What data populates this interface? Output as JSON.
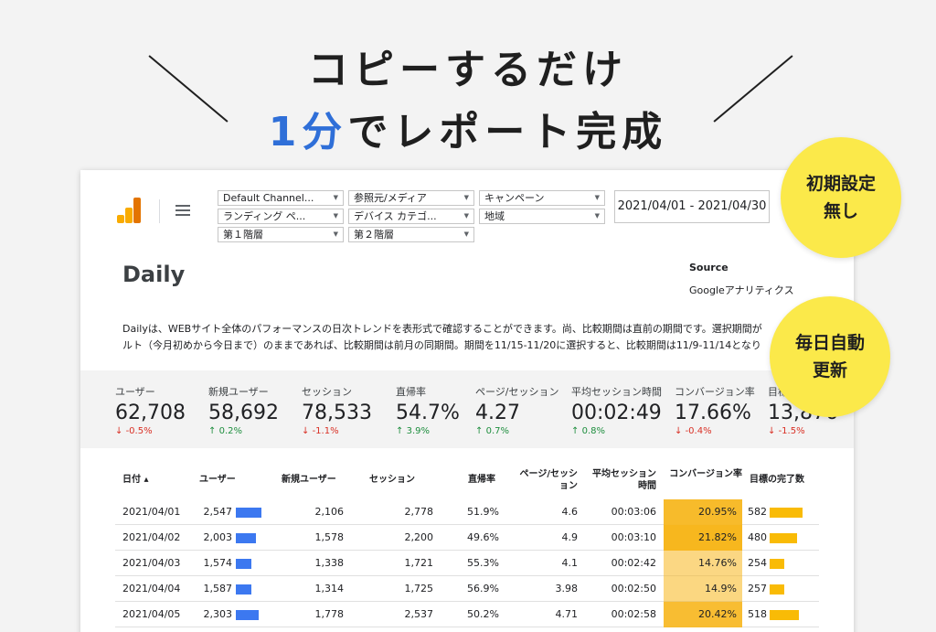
{
  "headline": {
    "line1": "コピーするだけ",
    "line2_accent": "1分",
    "line2_rest": "でレポート完成"
  },
  "badges": {
    "initial_setup": [
      "初期設定",
      "無し"
    ],
    "daily_update": [
      "毎日自動",
      "更新"
    ]
  },
  "filters": [
    "Default Channel...",
    "参照元/メディア",
    "キャンペーン",
    "ランディング ペ...",
    "デバイス カテゴ...",
    "地域",
    "第１階層",
    "第２階層"
  ],
  "date_range": "2021/04/01 - 2021/04/30",
  "report": {
    "title": "Daily",
    "source_label": "Source",
    "source_value": "Googleアナリティクス",
    "description_line1": "Dailyは、WEBサイト全体のパフォーマンスの日次トレンドを表形式で確認することができます。尚、比較期間は直前の期間です。選択期間が",
    "description_line2": "ルト（今月初めから今日まで）のままであれば、比較期間は前月の同期間。期間を11/15-11/20に選択すると、比較期間は11/9-11/14となり"
  },
  "kpis": [
    {
      "label": "ユーザー",
      "value": "62,708",
      "delta": "-0.5%",
      "dir": "down"
    },
    {
      "label": "新規ユーザー",
      "value": "58,692",
      "delta": "0.2%",
      "dir": "up"
    },
    {
      "label": "セッション",
      "value": "78,533",
      "delta": "-1.1%",
      "dir": "down"
    },
    {
      "label": "直帰率",
      "value": "54.7%",
      "delta": "3.9%",
      "dir": "up"
    },
    {
      "label": "ページ/セッション",
      "value": "4.27",
      "delta": "0.7%",
      "dir": "up"
    },
    {
      "label": "平均セッション時間",
      "value": "00:02:49",
      "delta": "0.8%",
      "dir": "up"
    },
    {
      "label": "コンバージョン率",
      "value": "17.66%",
      "delta": "-0.4%",
      "dir": "down"
    },
    {
      "label": "目標の完了数",
      "value": "13,876",
      "delta": "-1.5%",
      "dir": "down"
    }
  ],
  "table": {
    "headers": [
      "日付 ▴",
      "ユーザー",
      "新規ユーザー",
      "セッション",
      "直帰率",
      "ページ/セッション",
      "平均セッション時間",
      "コンバージョン率",
      "目標の完了数"
    ],
    "rows": [
      {
        "date": "2021/04/01",
        "users": "2,547",
        "users_n": 2547,
        "new_users": "2,106",
        "sessions": "2,778",
        "bounce": "51.9%",
        "pps": "4.6",
        "avg_time": "00:03:06",
        "conv": "20.95%",
        "conv_n": 20.95,
        "goals": "582",
        "goals_n": 582
      },
      {
        "date": "2021/04/02",
        "users": "2,003",
        "users_n": 2003,
        "new_users": "1,578",
        "sessions": "2,200",
        "bounce": "49.6%",
        "pps": "4.9",
        "avg_time": "00:03:10",
        "conv": "21.82%",
        "conv_n": 21.82,
        "goals": "480",
        "goals_n": 480
      },
      {
        "date": "2021/04/03",
        "users": "1,574",
        "users_n": 1574,
        "new_users": "1,338",
        "sessions": "1,721",
        "bounce": "55.3%",
        "pps": "4.1",
        "avg_time": "00:02:42",
        "conv": "14.76%",
        "conv_n": 14.76,
        "goals": "254",
        "goals_n": 254
      },
      {
        "date": "2021/04/04",
        "users": "1,587",
        "users_n": 1587,
        "new_users": "1,314",
        "sessions": "1,725",
        "bounce": "56.9%",
        "pps": "3.98",
        "avg_time": "00:02:50",
        "conv": "14.9%",
        "conv_n": 14.9,
        "goals": "257",
        "goals_n": 257
      },
      {
        "date": "2021/04/05",
        "users": "2,303",
        "users_n": 2303,
        "new_users": "1,778",
        "sessions": "2,537",
        "bounce": "50.2%",
        "pps": "4.71",
        "avg_time": "00:02:58",
        "conv": "20.42%",
        "conv_n": 20.42,
        "goals": "518",
        "goals_n": 518
      }
    ]
  },
  "colors": {
    "accent_blue": "#2f6fd8",
    "bar_blue": "#3c78f0",
    "bar_yellow": "#f9bb06",
    "badge_yellow": "#fbe94a",
    "delta_up": "#1e8e3e",
    "delta_down": "#d93025"
  }
}
